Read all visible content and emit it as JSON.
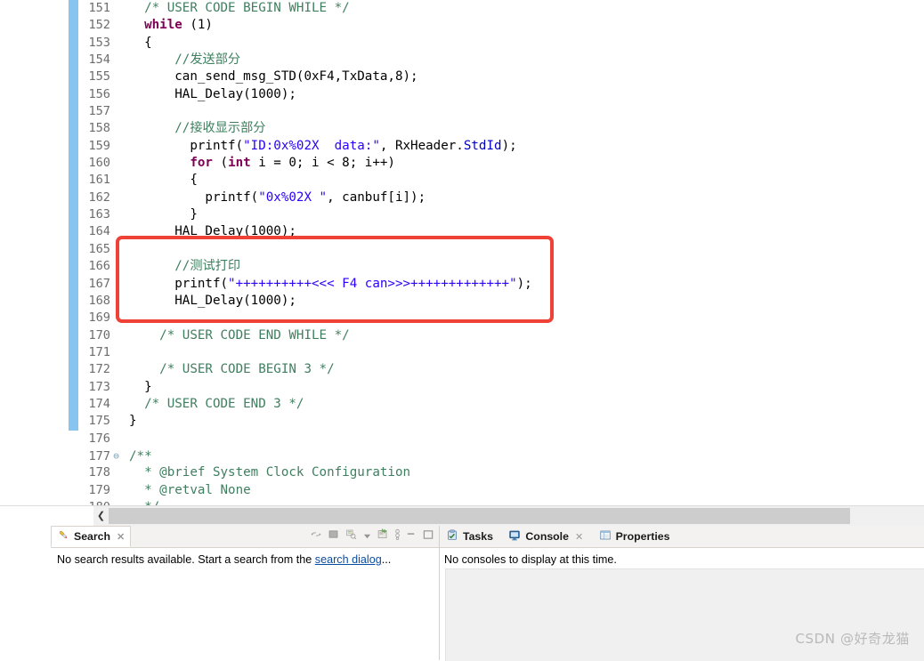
{
  "editor": {
    "first_line": 151,
    "lines": [
      {
        "n": 151,
        "fold": "",
        "tokens": [
          {
            "t": "cm",
            "s": "  /* USER CODE BEGIN WHILE */"
          }
        ]
      },
      {
        "n": 152,
        "fold": "",
        "tokens": [
          {
            "t": "pl",
            "s": "  "
          },
          {
            "t": "kw",
            "s": "while"
          },
          {
            "t": "pl",
            "s": " (1)"
          }
        ]
      },
      {
        "n": 153,
        "fold": "",
        "tokens": [
          {
            "t": "pl",
            "s": "  {"
          }
        ]
      },
      {
        "n": 154,
        "fold": "",
        "tokens": [
          {
            "t": "cm",
            "s": "      //发送部分"
          }
        ]
      },
      {
        "n": 155,
        "fold": "",
        "tokens": [
          {
            "t": "pl",
            "s": "      can_send_msg_STD(0xF4,TxData,8);"
          }
        ]
      },
      {
        "n": 156,
        "fold": "",
        "tokens": [
          {
            "t": "pl",
            "s": "      HAL_Delay(1000);"
          }
        ]
      },
      {
        "n": 157,
        "fold": "",
        "tokens": []
      },
      {
        "n": 158,
        "fold": "",
        "tokens": [
          {
            "t": "cm",
            "s": "      //接收显示部分"
          }
        ]
      },
      {
        "n": 159,
        "fold": "",
        "tokens": [
          {
            "t": "pl",
            "s": "        printf("
          },
          {
            "t": "str",
            "s": "\"ID:0x%02X  data:\""
          },
          {
            "t": "pl",
            "s": ", RxHeader."
          },
          {
            "t": "fld",
            "s": "StdId"
          },
          {
            "t": "pl",
            "s": ");"
          }
        ]
      },
      {
        "n": 160,
        "fold": "",
        "tokens": [
          {
            "t": "pl",
            "s": "        "
          },
          {
            "t": "kw",
            "s": "for"
          },
          {
            "t": "pl",
            "s": " ("
          },
          {
            "t": "kw",
            "s": "int"
          },
          {
            "t": "pl",
            "s": " i = 0; i < 8; i++)"
          }
        ]
      },
      {
        "n": 161,
        "fold": "",
        "tokens": [
          {
            "t": "pl",
            "s": "        {"
          }
        ]
      },
      {
        "n": 162,
        "fold": "",
        "tokens": [
          {
            "t": "pl",
            "s": "          printf("
          },
          {
            "t": "str",
            "s": "\"0x%02X \""
          },
          {
            "t": "pl",
            "s": ", canbuf[i]);"
          }
        ]
      },
      {
        "n": 163,
        "fold": "",
        "tokens": [
          {
            "t": "pl",
            "s": "        }"
          }
        ]
      },
      {
        "n": 164,
        "fold": "",
        "tokens": [
          {
            "t": "pl",
            "s": "      HAL_Delay(1000);"
          }
        ]
      },
      {
        "n": 165,
        "fold": "",
        "tokens": []
      },
      {
        "n": 166,
        "fold": "",
        "tokens": [
          {
            "t": "cm",
            "s": "      //测试打印"
          }
        ]
      },
      {
        "n": 167,
        "fold": "",
        "tokens": [
          {
            "t": "pl",
            "s": "      printf("
          },
          {
            "t": "str",
            "s": "\"++++++++++<<< F4 can>>>+++++++++++++\""
          },
          {
            "t": "pl",
            "s": ");"
          }
        ]
      },
      {
        "n": 168,
        "fold": "",
        "tokens": [
          {
            "t": "pl",
            "s": "      HAL_Delay(1000);"
          }
        ]
      },
      {
        "n": 169,
        "fold": "",
        "tokens": []
      },
      {
        "n": 170,
        "fold": "",
        "tokens": [
          {
            "t": "cm",
            "s": "    /* USER CODE END WHILE */"
          }
        ]
      },
      {
        "n": 171,
        "fold": "",
        "tokens": []
      },
      {
        "n": 172,
        "fold": "",
        "tokens": [
          {
            "t": "cm",
            "s": "    /* USER CODE BEGIN 3 */"
          }
        ]
      },
      {
        "n": 173,
        "fold": "",
        "tokens": [
          {
            "t": "pl",
            "s": "  }"
          }
        ]
      },
      {
        "n": 174,
        "fold": "",
        "tokens": [
          {
            "t": "cm",
            "s": "  /* USER CODE END 3 */"
          }
        ]
      },
      {
        "n": 175,
        "fold": "",
        "tokens": [
          {
            "t": "pl",
            "s": "}"
          }
        ]
      },
      {
        "n": 176,
        "fold": "",
        "tokens": []
      },
      {
        "n": 177,
        "fold": "⊖",
        "tokens": [
          {
            "t": "cm",
            "s": "/**"
          }
        ]
      },
      {
        "n": 178,
        "fold": "",
        "tokens": [
          {
            "t": "cm",
            "s": "  * @brief System Clock Configuration"
          }
        ]
      },
      {
        "n": 179,
        "fold": "",
        "tokens": [
          {
            "t": "cm",
            "s": "  * @retval None"
          }
        ]
      },
      {
        "n": 180,
        "fold": "",
        "tokens": [
          {
            "t": "cm",
            "s": "  */"
          }
        ]
      }
    ],
    "scrollbar": {
      "left_arrow": "❮"
    },
    "highlight_box_color": "#ef4136",
    "change_bar_color": "#87c5f0"
  },
  "search_view": {
    "tab_label": "Search",
    "tab_close": "✕",
    "message_prefix": "No search results available. Start a search from the ",
    "message_link": "search dialog",
    "message_suffix": "...",
    "toolbar_icons": [
      "pin-view-icon",
      "stop-search-icon",
      "show-previous-searches-icon",
      "view-menu-dropdown-icon",
      "new-search-icon",
      "run-current-search-icon",
      "minimize-icon",
      "maximize-icon"
    ]
  },
  "console_view": {
    "tabs": [
      {
        "label": "Tasks",
        "icon": "tasks-icon",
        "active": false,
        "closable": false
      },
      {
        "label": "Console",
        "icon": "console-icon",
        "active": true,
        "closable": true
      },
      {
        "label": "Properties",
        "icon": "properties-icon",
        "active": false,
        "closable": false
      }
    ],
    "tab_close": "✕",
    "message": "No consoles to display at this time."
  },
  "watermark": {
    "text": "CSDN @好奇龙猫"
  }
}
